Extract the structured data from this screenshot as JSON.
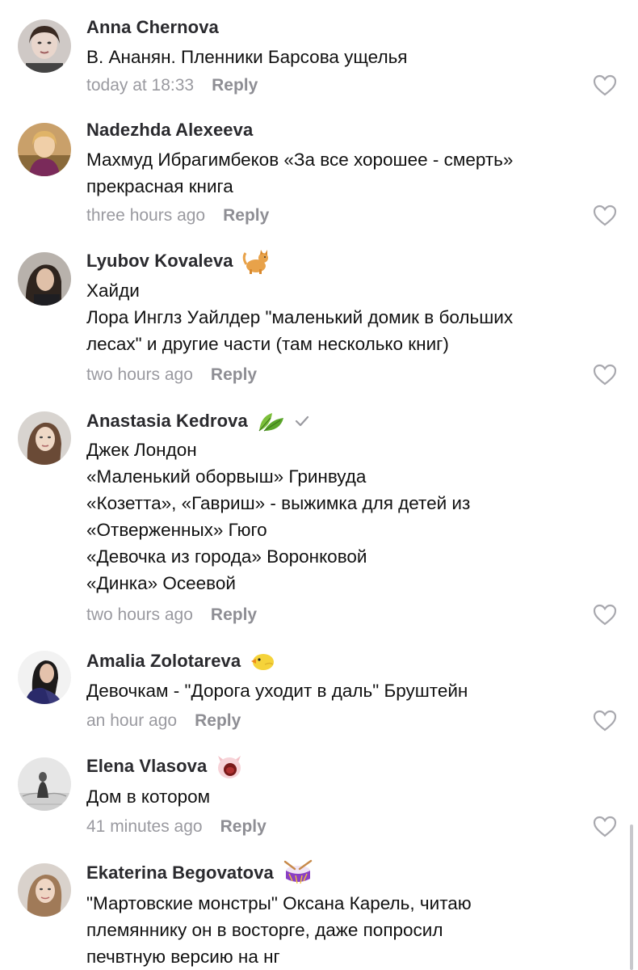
{
  "comments": [
    {
      "author": "Anna Chernova",
      "lines": [
        "В. Ананян. Пленники Барсова ущелья"
      ],
      "time": "today at 18:33",
      "reply_label": "Reply",
      "avatar_icon": "user-photo",
      "emoji_icon": null
    },
    {
      "author": "Nadezhda Alexeeva",
      "lines": [
        "Махмуд Ибрагимбеков «За все хорошее - смерть»",
        "прекрасная книга"
      ],
      "time": "three hours ago",
      "reply_label": "Reply",
      "avatar_icon": "user-photo",
      "emoji_icon": null
    },
    {
      "author": "Lyubov Kovaleva",
      "lines": [
        "Хайди",
        "Лора Инглз Уайлдер \"маленький домик в больших",
        "лесах\" и другие части (там несколько книг)"
      ],
      "time": "two hours ago",
      "reply_label": "Reply",
      "avatar_icon": "user-photo",
      "emoji_icon": "cat-emoji"
    },
    {
      "author": "Anastasia Kedrova",
      "lines": [
        "Джек Лондон",
        "«Маленький оборвыш» Гринвуда",
        "«Козетта», «Гавриш» - выжимка для детей из",
        "«Отверженных» Гюго",
        "«Девочка из города» Воронковой",
        "«Динка» Осеевой"
      ],
      "time": "two hours ago",
      "reply_label": "Reply",
      "avatar_icon": "user-photo",
      "emoji_icon": "leaves-emoji",
      "verified": true
    },
    {
      "author": "Amalia Zolotareva",
      "lines": [
        "Девочкам - \"Дорога уходит в даль\" Бруштейн"
      ],
      "time": "an hour ago",
      "reply_label": "Reply",
      "avatar_icon": "user-photo",
      "emoji_icon": "chick-emoji"
    },
    {
      "author": "Elena Vlasova",
      "lines": [
        "Дом в котором"
      ],
      "time": "41 minutes ago",
      "reply_label": "Reply",
      "avatar_icon": "user-photo",
      "emoji_icon": "pig-emoji"
    },
    {
      "author": "Ekaterina Begovatova",
      "lines": [
        "\"Мартовские монстры\" Оксана Карель, читаю",
        "племяннику он в восторге, даже попросил",
        "печвтную версию на нг"
      ],
      "time": "",
      "reply_label": "",
      "avatar_icon": "user-photo",
      "emoji_icon": "drum-emoji"
    }
  ],
  "colors": {
    "name": "#2a2a2e",
    "text": "#111111",
    "time": "#9a9aa0",
    "reply": "#8e8e94",
    "heart": "#a8a8ae"
  }
}
